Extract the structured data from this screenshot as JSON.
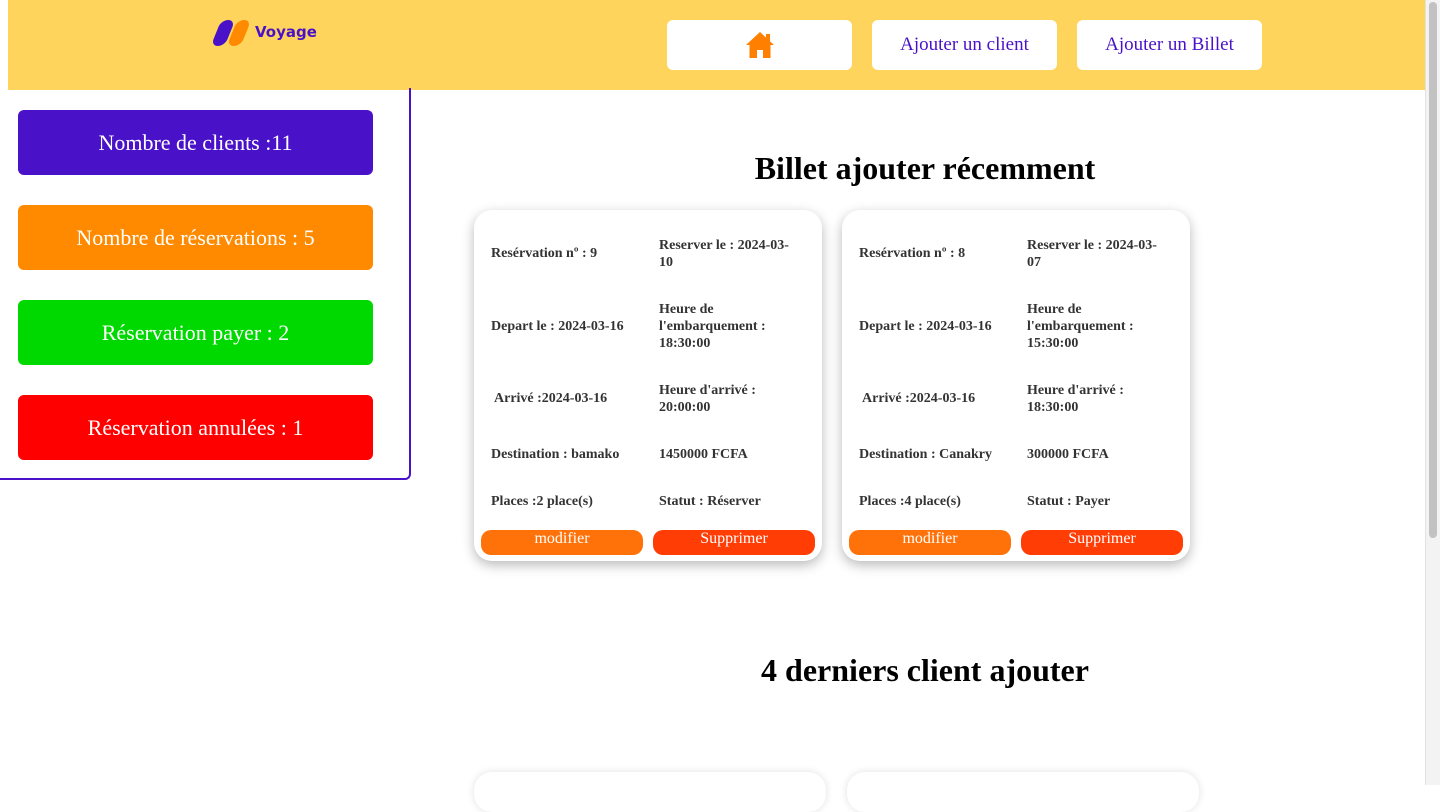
{
  "brand": {
    "name": "Voyage"
  },
  "nav": {
    "home_icon": "home-icon",
    "add_client": "Ajouter un client",
    "add_ticket": "Ajouter un Billet"
  },
  "colors": {
    "header": "#ffd45c",
    "accent": "#4a12c8",
    "orange": "#ff8a00",
    "green": "#00d900",
    "red": "#ff0000"
  },
  "stats": [
    {
      "label": "Nombre de clients :11",
      "color": "#4a12c8"
    },
    {
      "label": "Nombre de réservations : 5",
      "color": "#ff8a00"
    },
    {
      "label": "Réservation payer : 2",
      "color": "#00d900"
    },
    {
      "label": "Réservation annulées : 1",
      "color": "#ff0000"
    }
  ],
  "recent_tickets": {
    "title": "Billet ajouter récemment",
    "cards": [
      {
        "reservation": "Resérvation nº : 9",
        "reserved_on": "Reserver le : 2024-03-10",
        "departure": "Depart le : 2024-03-16",
        "boarding_time": "Heure de l'embarquement : 18:30:00",
        "arrival": "Arrivé :2024-03-16",
        "arrival_time": "Heure d'arrivé : 20:00:00",
        "destination": "Destination : bamako",
        "price": "1450000 FCFA",
        "places": "Places :2 place(s)",
        "status": "Statut : Réserver",
        "edit_label": "modifier",
        "delete_label": "Supprimer"
      },
      {
        "reservation": "Resérvation nº : 8",
        "reserved_on": "Reserver le : 2024-03-07",
        "departure": "Depart le : 2024-03-16",
        "boarding_time": "Heure de l'embarquement : 15:30:00",
        "arrival": "Arrivé :2024-03-16",
        "arrival_time": "Heure d'arrivé : 18:30:00",
        "destination": "Destination : Canakry",
        "price": "300000 FCFA",
        "places": "Places :4 place(s)",
        "status": "Statut : Payer",
        "edit_label": "modifier",
        "delete_label": "Supprimer"
      }
    ]
  },
  "recent_clients": {
    "title": "4 derniers client ajouter"
  }
}
